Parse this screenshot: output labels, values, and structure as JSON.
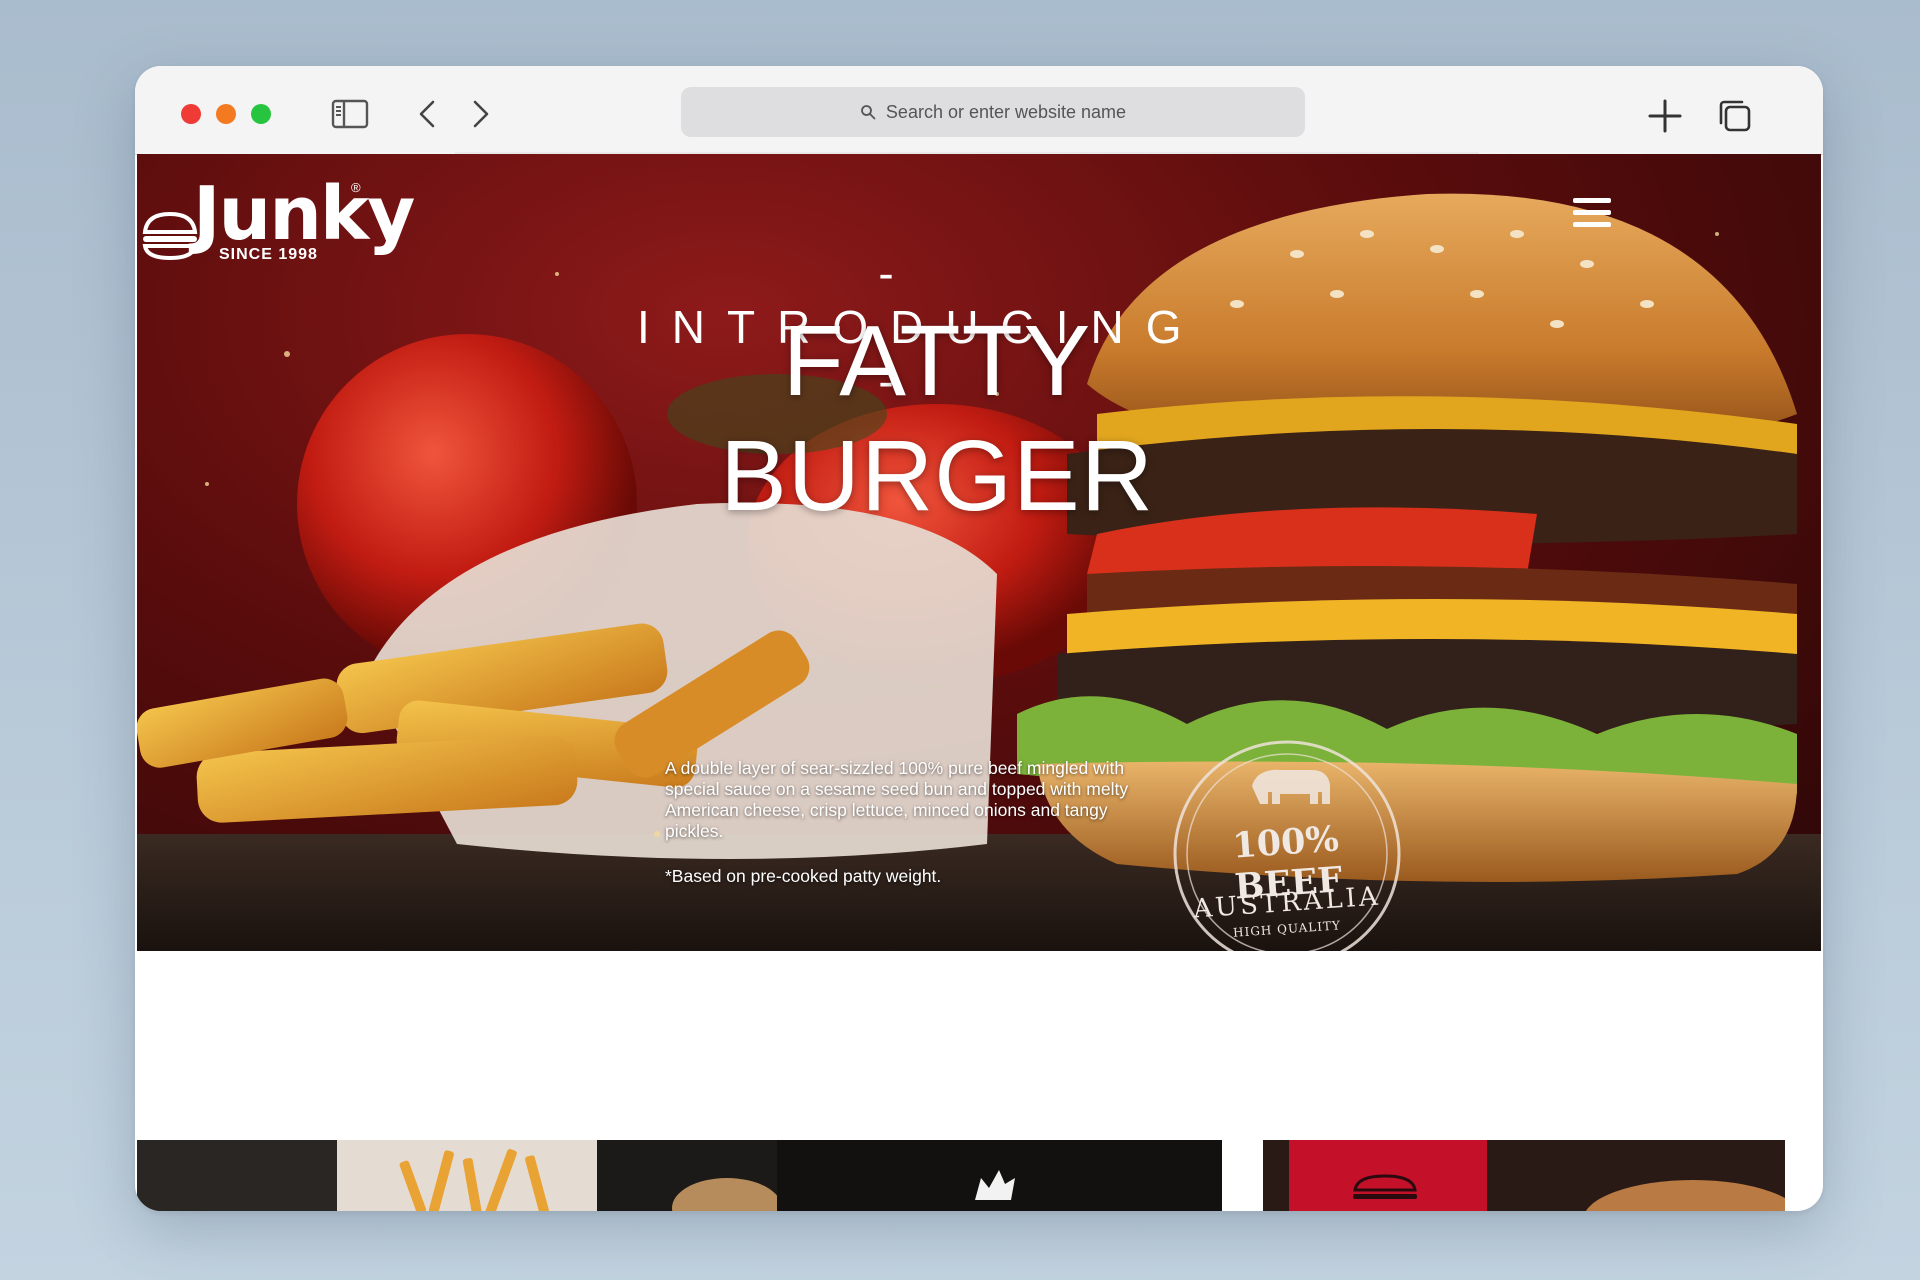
{
  "browser": {
    "address_placeholder": "Search or enter website name",
    "icons": [
      "sidebar-icon",
      "back-arrow-icon",
      "forward-arrow-icon",
      "search-icon",
      "new-tab-plus-icon",
      "tab-overview-icon"
    ]
  },
  "site": {
    "logo_word": "Junky",
    "logo_since": "SINCE 1998",
    "logo_reg": "®",
    "menu_icon": "hamburger-menu-icon"
  },
  "hero": {
    "kicker": "- INTRODUCING -",
    "title": "FATTY BURGER",
    "description": "A double layer of sear-sizzled 100% pure beef mingled with special sauce on a sesame seed bun and topped with melty American cheese, crisp lettuce, minced onions and tangy pickles.",
    "footnote": "*Based on pre-cooked patty weight.",
    "badge_main": "100% BEEF",
    "badge_origin": "AUSTRALIA",
    "badge_quality": "HIGH QUALITY"
  },
  "colors": {
    "accent_red": "#c5102a",
    "hero_dark_red": "#5a0c0c",
    "traffic_red": "#f03a35",
    "traffic_yellow": "#f47a22",
    "traffic_green": "#27c53f"
  }
}
